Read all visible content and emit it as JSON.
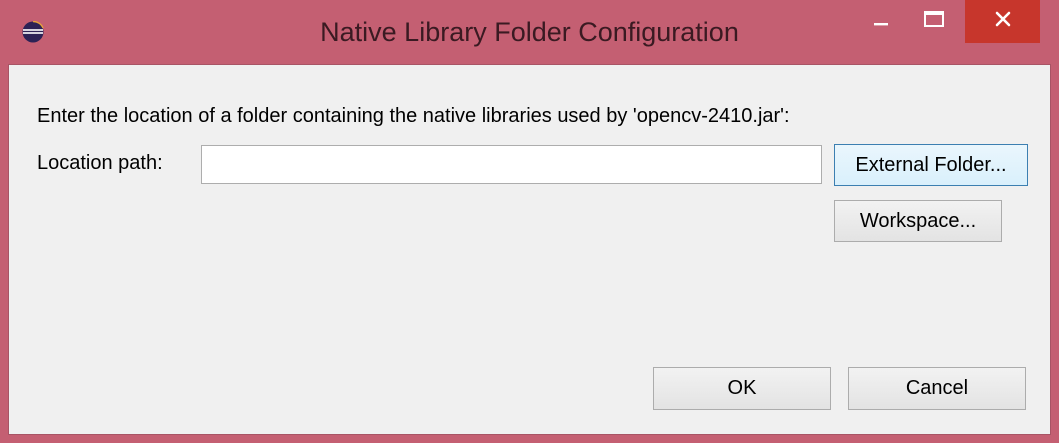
{
  "window": {
    "title": "Native Library Folder Configuration",
    "app_icon": "eclipse-icon",
    "controls": {
      "minimize_icon": "minimize-icon",
      "maximize_icon": "maximize-icon",
      "close_icon": "close-icon"
    },
    "colors": {
      "titlebar": "#c45f72",
      "close_button": "#c7362c",
      "client_background": "#f0f0f0"
    }
  },
  "dialog": {
    "instruction": "Enter the location of a folder containing the native libraries used by 'opencv-2410.jar':",
    "location_label": "Location path:",
    "location_value": "",
    "external_folder_label": "External Folder...",
    "workspace_label": "Workspace...",
    "ok_label": "OK",
    "cancel_label": "Cancel"
  }
}
